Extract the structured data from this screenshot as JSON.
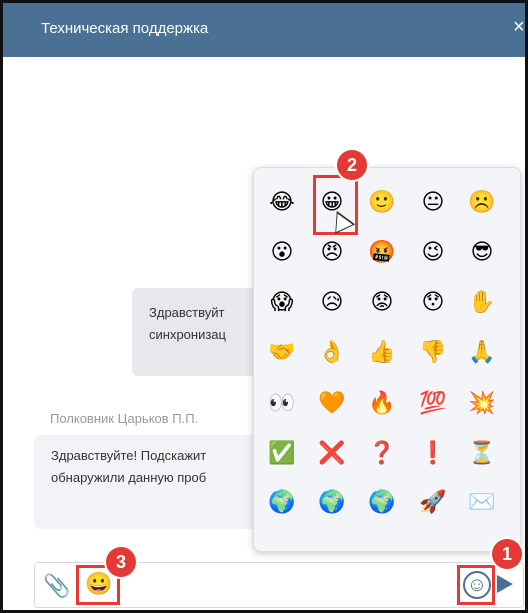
{
  "header": {
    "title": "Техническая поддержка",
    "close_icon": "×"
  },
  "incoming": {
    "line1": "Здравствуйт",
    "line2": "синхронизац"
  },
  "author": "Полковник Царьков П.П.",
  "outgoing": {
    "line1": "Здравствуйте! Подскажит",
    "line2": "обнаружили данную проб"
  },
  "picker": {
    "rows": [
      [
        "😂",
        "😀",
        "🙂",
        "😐",
        "☹️"
      ],
      [
        "😮",
        "😠",
        "🤬",
        "😉",
        "😎"
      ],
      [
        "😱",
        "😥",
        "😟",
        "😯",
        "✋"
      ],
      [
        "🤝",
        "👌",
        "👍",
        "👎",
        "🙏"
      ],
      [
        "👀",
        "🧡",
        "🔥",
        "💯",
        "💥"
      ],
      [
        "✅",
        "❌",
        "❓",
        "❗",
        "⏳"
      ],
      [
        "🌍",
        "🌍",
        "🌍",
        "🚀",
        "✉️"
      ]
    ]
  },
  "input": {
    "emoji": "😀",
    "clip_icon": "📎",
    "smile_icon": "☺"
  },
  "annotations": {
    "b1": "1",
    "b2": "2",
    "b3": "3"
  }
}
